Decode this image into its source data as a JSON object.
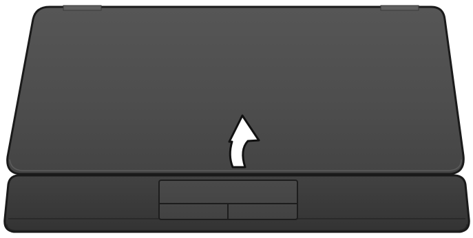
{
  "illustration": {
    "subject": "laptop-closed-lid",
    "action_hint": "arrow-up-icon",
    "colors": {
      "outline": "#1a1a1a",
      "lid_top": "#545454",
      "lid_bottom": "#474747",
      "base": "#3a3a3a",
      "base_edge": "#2b2b2b",
      "touchpad": "#454545",
      "hinge": "#5f5f5f",
      "arrow_fill": "#ffffff"
    }
  }
}
